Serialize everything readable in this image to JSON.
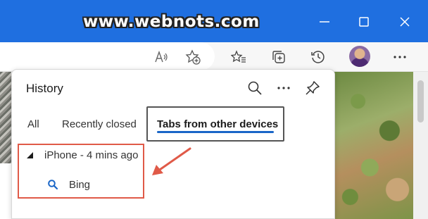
{
  "watermark": "www.webnots.com",
  "window_controls": [
    "minimize-icon",
    "maximize-icon",
    "close-icon"
  ],
  "toolbar": {
    "icons": [
      "read-aloud-icon",
      "add-favorite-icon",
      "favorites-icon",
      "collections-icon",
      "history-icon",
      "avatar",
      "more-icon"
    ]
  },
  "history": {
    "title": "History",
    "icons": [
      "search-icon",
      "more-options-icon",
      "pin-icon"
    ],
    "tabs": [
      {
        "label": "All",
        "selected": false
      },
      {
        "label": "Recently closed",
        "selected": false
      },
      {
        "label": "Tabs from other devices",
        "selected": true
      }
    ],
    "device": {
      "label": "iPhone - 4 mins ago",
      "items": [
        {
          "label": "Bing",
          "icon": "search-icon"
        }
      ]
    }
  },
  "colors": {
    "titlebar": "#1f6fe0",
    "accent_underline": "#1a66c7",
    "annotation": "#e05a48",
    "search_icon": "#1a66c7"
  }
}
